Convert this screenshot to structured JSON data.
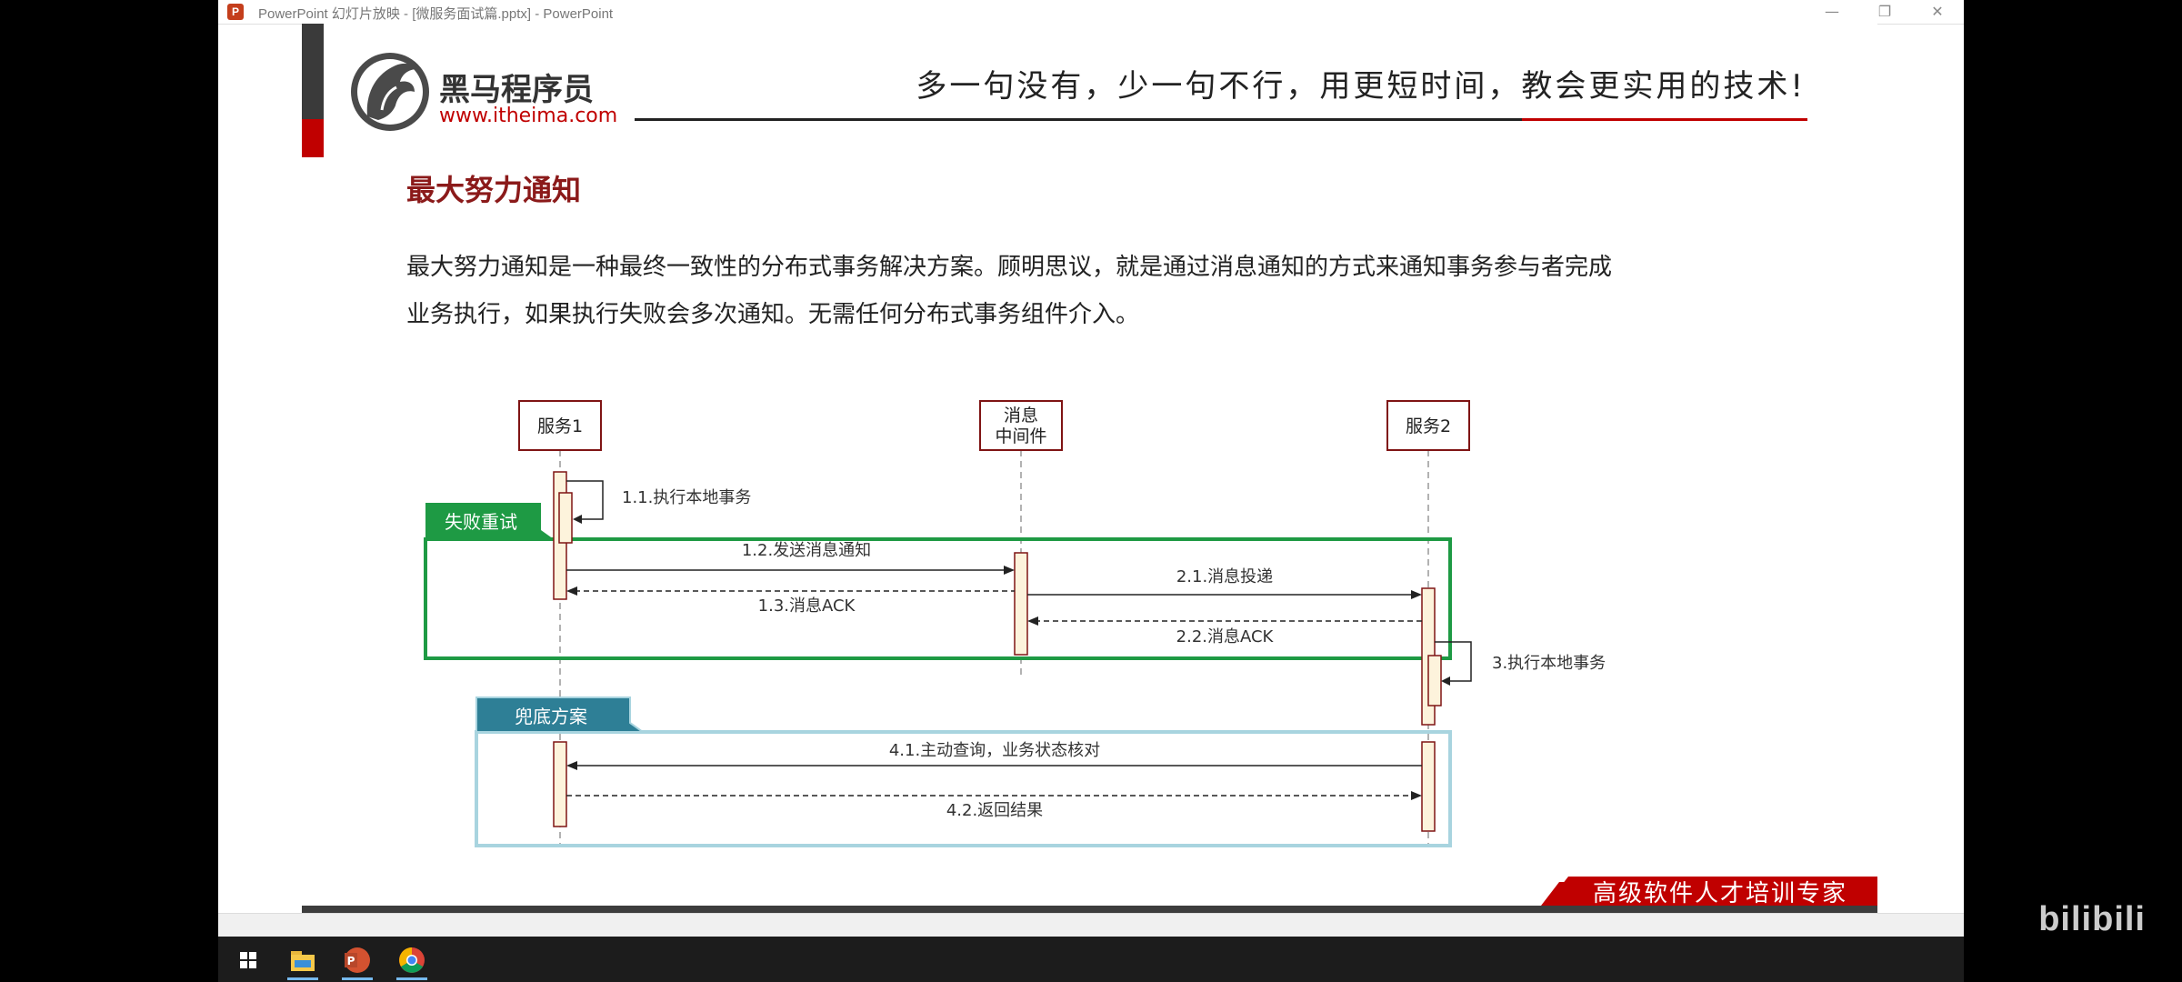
{
  "window": {
    "title": "PowerPoint 幻灯片放映 - [微服务面试篇.pptx] - PowerPoint",
    "app_icon_letter": "P",
    "controls": {
      "minimize": "—",
      "restore": "❐",
      "close": "✕"
    }
  },
  "slide": {
    "logo_name": "黑马程序员",
    "logo_url": "www.itheima.com",
    "slogan": "多一句没有，少一句不行，用更短时间，教会更实用的技术!",
    "title": "最大努力通知",
    "body_line1": "最大努力通知是一种最终一致性的分布式事务解决方案。顾明思议，就是通过消息通知的方式来通知事务参与者完成",
    "body_line2": "业务执行，如果执行失败会多次通知。无需任何分布式事务组件介入。",
    "footer_banner": "高级软件人才培训专家",
    "colors": {
      "title": "#8b1a1a",
      "accent_red": "#c00000",
      "green": "#1e9a44",
      "teal": "#2e7f96",
      "teal_border": "#a8d4df",
      "participant_border": "#7f1414",
      "activation_fill": "#fdf3dc"
    }
  },
  "diagram": {
    "participants": [
      {
        "id": "s1",
        "label": "服务1"
      },
      {
        "id": "mq",
        "label_line1": "消息",
        "label_line2": "中间件"
      },
      {
        "id": "s2",
        "label": "服务2"
      }
    ],
    "groups": {
      "retry": "失败重试",
      "fallback": "兜底方案"
    },
    "messages": {
      "m11": "1.1.执行本地事务",
      "m12": "1.2.发送消息通知",
      "m13": "1.3.消息ACK",
      "m21": "2.1.消息投递",
      "m22": "2.2.消息ACK",
      "m3": "3.执行本地事务",
      "m41": "4.1.主动查询，业务状态核对",
      "m42": "4.2.返回结果"
    }
  },
  "taskbar": {
    "items": [
      "start-icon",
      "file-explorer-icon",
      "powerpoint-icon",
      "chrome-icon"
    ]
  },
  "watermark": {
    "text": "bilibili"
  }
}
